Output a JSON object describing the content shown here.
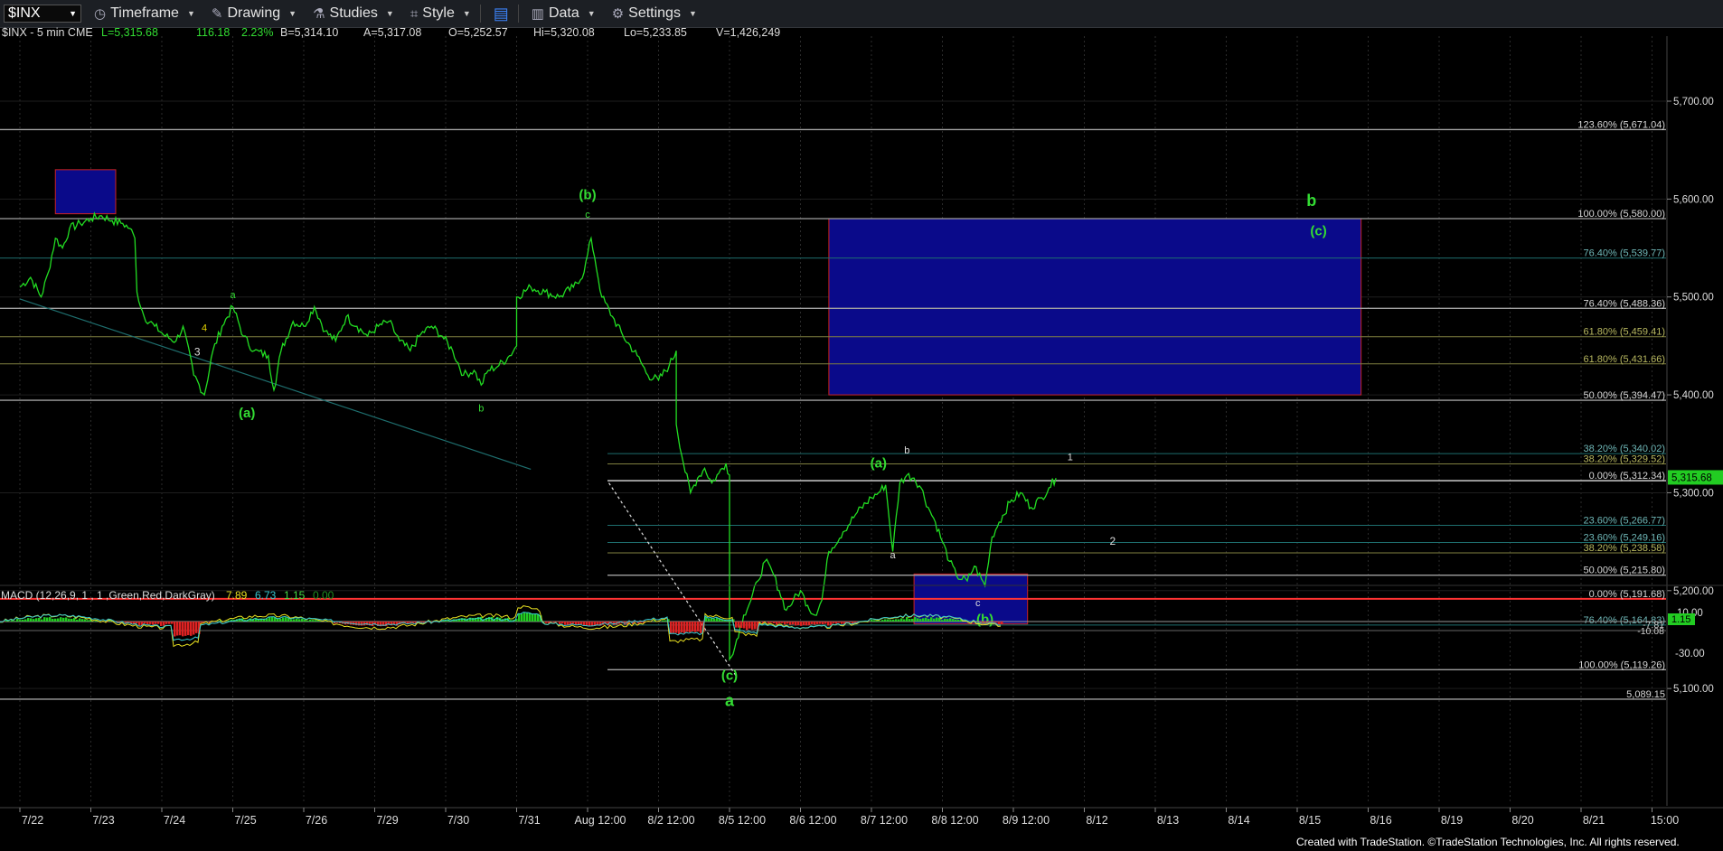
{
  "toolbar": {
    "symbol": "$INX",
    "items": [
      {
        "label": "Timeframe",
        "icon": "clock-icon"
      },
      {
        "label": "Drawing",
        "icon": "pencil-icon"
      },
      {
        "label": "Studies",
        "icon": "flask-icon"
      },
      {
        "label": "Style",
        "icon": "style-icon"
      },
      {
        "label": "",
        "icon": "layout-icon"
      },
      {
        "label": "Data",
        "icon": "bar-chart-icon"
      },
      {
        "label": "Settings",
        "icon": "gear-icon"
      }
    ]
  },
  "header": {
    "title": "$INX - 5 min  CME",
    "L": "L=5,315.68",
    "chg": "116.18",
    "pct": "2.23%",
    "B": "B=5,314.10",
    "A": "A=5,317.08",
    "O": "O=5,252.57",
    "Hi": "Hi=5,320.08",
    "Lo": "Lo=5,233.85",
    "V": "V=1,426,249"
  },
  "colors": {
    "bg": "#000000",
    "price": "#22dd22",
    "wave_label": "#33dd33",
    "grid": "#2a2a2a",
    "zone_fill": "#0a0a8a",
    "zone_border": "#cc2222",
    "red_line": "#ff3333",
    "teal": "#1e6e6e",
    "gray": "#a0a0a0",
    "olive": "#808040"
  },
  "chart_data": {
    "type": "line",
    "title": "$INX - 5 min",
    "y_axis": {
      "range": [
        5040,
        5720
      ],
      "ticks": [
        5100,
        5200,
        5300,
        5400,
        5500,
        5600,
        5700
      ],
      "labels": [
        "5,100.00",
        "5,200.00",
        "5,300.00",
        "5,400.00",
        "5,500.00",
        "5,600.00",
        "5,700.00"
      ]
    },
    "x_axis": {
      "labels": [
        "7/22",
        "7/23",
        "7/24",
        "7/25",
        "7/26",
        "7/29",
        "7/30",
        "7/31",
        "Aug 12:00",
        "8/2 12:00",
        "8/5 12:00",
        "8/6 12:00",
        "8/7 12:00",
        "8/8 12:00",
        "8/9 12:00",
        "8/12",
        "8/13",
        "8/14",
        "8/15",
        "8/16",
        "8/19",
        "8/20",
        "8/21",
        "15:00"
      ]
    },
    "last_price": "5,315.68",
    "fib_levels": [
      {
        "label": "123.60% (5,671.04)",
        "value": 5671,
        "color": "gray"
      },
      {
        "label": "100.00% (5,580.00)",
        "value": 5580,
        "color": "gray"
      },
      {
        "label": "76.40% (5,539.77)",
        "value": 5539.77,
        "color": "teal"
      },
      {
        "label": "76.40% (5,488.36)",
        "value": 5488.36,
        "color": "gray"
      },
      {
        "label": "61.80% (5,459.41)",
        "value": 5459.41,
        "color": "olive"
      },
      {
        "label": "61.80% (5,431.66)",
        "value": 5431.66,
        "color": "olive"
      },
      {
        "label": "50.00% (5,394.47)",
        "value": 5394.47,
        "color": "gray"
      },
      {
        "label": "38.20% (5,340.02)",
        "value": 5340.02,
        "color": "teal"
      },
      {
        "label": "38.20% (5,329.52)",
        "value": 5329.52,
        "color": "olive"
      },
      {
        "label": "0.00% (5,312.34)",
        "value": 5312.34,
        "color": "white"
      },
      {
        "label": "23.60% (5,266.77)",
        "value": 5266.77,
        "color": "teal"
      },
      {
        "label": "23.60% (5,249.16)",
        "value": 5249.16,
        "color": "teal"
      },
      {
        "label": "38.20% (5,238.58)",
        "value": 5238.58,
        "color": "olive"
      },
      {
        "label": "50.00% (5,215.80)",
        "value": 5215.8,
        "color": "gray"
      },
      {
        "label": "0.00% (5,191.68)",
        "value": 5191.68,
        "color": "red"
      },
      {
        "label": "76.40% (5,164.83)",
        "value": 5164.83,
        "color": "teal"
      },
      {
        "label": "100.00% (5,119.26)",
        "value": 5119.26,
        "color": "gray"
      },
      {
        "label": "5,089.15",
        "value": 5089.15,
        "color": "gray"
      }
    ],
    "zones": [
      {
        "name": "upper-left-zone",
        "x": [
          0.5,
          1.35
        ],
        "y": [
          5585,
          5630
        ]
      },
      {
        "name": "target-zone-b",
        "x": [
          11.4,
          18.9
        ],
        "y": [
          5400,
          5580
        ]
      },
      {
        "name": "support-zone-b",
        "x": [
          12.6,
          14.2
        ],
        "y": [
          5166,
          5217
        ]
      }
    ],
    "wave_labels": [
      {
        "text": "(b)",
        "x": 8.0,
        "y": 5600,
        "color": "green",
        "size": 15
      },
      {
        "text": "c",
        "x": 8.0,
        "y": 5581,
        "color": "green",
        "size": 11
      },
      {
        "text": "b",
        "x": 18.2,
        "y": 5593,
        "color": "green",
        "size": 18
      },
      {
        "text": "(c)",
        "x": 18.3,
        "y": 5563,
        "color": "green",
        "size": 15
      },
      {
        "text": "a",
        "x": 3.0,
        "y": 5499,
        "color": "green",
        "size": 11
      },
      {
        "text": "4",
        "x": 2.6,
        "y": 5465,
        "color": "yellow",
        "size": 11
      },
      {
        "text": "3",
        "x": 2.5,
        "y": 5440,
        "color": "white",
        "size": 12
      },
      {
        "text": "(a)",
        "x": 3.2,
        "y": 5377,
        "color": "green",
        "size": 15
      },
      {
        "text": "b",
        "x": 6.5,
        "y": 5383,
        "color": "green",
        "size": 11
      },
      {
        "text": "(a)",
        "x": 12.1,
        "y": 5326,
        "color": "green",
        "size": 15
      },
      {
        "text": "b",
        "x": 12.5,
        "y": 5340,
        "color": "white",
        "size": 11
      },
      {
        "text": "1",
        "x": 14.8,
        "y": 5333,
        "color": "white",
        "size": 11
      },
      {
        "text": "a",
        "x": 12.3,
        "y": 5233,
        "color": "white",
        "size": 11
      },
      {
        "text": "2",
        "x": 15.4,
        "y": 5247,
        "color": "white",
        "size": 12
      },
      {
        "text": "c",
        "x": 13.5,
        "y": 5184,
        "color": "white",
        "size": 11
      },
      {
        "text": "(b)",
        "x": 13.6,
        "y": 5166,
        "color": "green",
        "size": 15
      },
      {
        "text": "(c)",
        "x": 10.0,
        "y": 5109,
        "color": "green",
        "size": 15
      },
      {
        "text": "a",
        "x": 10.0,
        "y": 5082,
        "color": "green",
        "size": 18
      }
    ],
    "price_series": [
      [
        0,
        5510
      ],
      [
        0.15,
        5520
      ],
      [
        0.3,
        5500
      ],
      [
        0.4,
        5525
      ],
      [
        0.5,
        5560
      ],
      [
        0.6,
        5550
      ],
      [
        0.7,
        5570
      ],
      [
        0.85,
        5575
      ],
      [
        1.0,
        5580
      ],
      [
        1.15,
        5583
      ],
      [
        1.3,
        5578
      ],
      [
        1.45,
        5575
      ],
      [
        1.55,
        5570
      ],
      [
        1.62,
        5560
      ],
      [
        1.65,
        5505
      ],
      [
        1.75,
        5480
      ],
      [
        1.9,
        5470
      ],
      [
        2.05,
        5460
      ],
      [
        2.2,
        5455
      ],
      [
        2.3,
        5470
      ],
      [
        2.45,
        5420
      ],
      [
        2.6,
        5400
      ],
      [
        2.72,
        5445
      ],
      [
        2.85,
        5470
      ],
      [
        3.0,
        5490
      ],
      [
        3.15,
        5460
      ],
      [
        3.3,
        5445
      ],
      [
        3.5,
        5440
      ],
      [
        3.58,
        5405
      ],
      [
        3.68,
        5445
      ],
      [
        3.85,
        5475
      ],
      [
        4.0,
        5470
      ],
      [
        4.15,
        5490
      ],
      [
        4.3,
        5465
      ],
      [
        4.45,
        5455
      ],
      [
        4.6,
        5480
      ],
      [
        4.75,
        5470
      ],
      [
        4.9,
        5460
      ],
      [
        5.05,
        5470
      ],
      [
        5.2,
        5475
      ],
      [
        5.35,
        5455
      ],
      [
        5.5,
        5445
      ],
      [
        5.65,
        5462
      ],
      [
        5.8,
        5470
      ],
      [
        5.95,
        5460
      ],
      [
        6.1,
        5445
      ],
      [
        6.25,
        5420
      ],
      [
        6.4,
        5425
      ],
      [
        6.5,
        5410
      ],
      [
        6.6,
        5425
      ],
      [
        6.75,
        5430
      ],
      [
        6.9,
        5440
      ],
      [
        7.0,
        5450
      ],
      [
        7.0,
        5500
      ],
      [
        7.2,
        5510
      ],
      [
        7.4,
        5505
      ],
      [
        7.6,
        5500
      ],
      [
        7.8,
        5510
      ],
      [
        7.95,
        5525
      ],
      [
        8.05,
        5560
      ],
      [
        8.1,
        5540
      ],
      [
        8.2,
        5500
      ],
      [
        8.35,
        5480
      ],
      [
        8.5,
        5460
      ],
      [
        8.7,
        5440
      ],
      [
        8.85,
        5420
      ],
      [
        9.0,
        5415
      ],
      [
        9.15,
        5430
      ],
      [
        9.25,
        5445
      ],
      [
        9.25,
        5370
      ],
      [
        9.35,
        5330
      ],
      [
        9.45,
        5300
      ],
      [
        9.55,
        5315
      ],
      [
        9.65,
        5325
      ],
      [
        9.75,
        5310
      ],
      [
        9.85,
        5320
      ],
      [
        9.95,
        5330
      ],
      [
        10.0,
        5318
      ],
      [
        10.0,
        5130
      ],
      [
        10.05,
        5135
      ],
      [
        10.1,
        5150
      ],
      [
        10.2,
        5175
      ],
      [
        10.3,
        5190
      ],
      [
        10.4,
        5210
      ],
      [
        10.5,
        5230
      ],
      [
        10.6,
        5220
      ],
      [
        10.7,
        5200
      ],
      [
        10.8,
        5180
      ],
      [
        10.9,
        5190
      ],
      [
        11.0,
        5200
      ],
      [
        11.1,
        5185
      ],
      [
        11.2,
        5175
      ],
      [
        11.3,
        5190
      ],
      [
        11.4,
        5240
      ],
      [
        11.6,
        5260
      ],
      [
        11.8,
        5280
      ],
      [
        12.0,
        5295
      ],
      [
        12.1,
        5300
      ],
      [
        12.2,
        5308
      ],
      [
        12.3,
        5240
      ],
      [
        12.4,
        5310
      ],
      [
        12.5,
        5318
      ],
      [
        12.6,
        5315
      ],
      [
        12.7,
        5305
      ],
      [
        12.8,
        5285
      ],
      [
        12.9,
        5270
      ],
      [
        13.0,
        5250
      ],
      [
        13.1,
        5230
      ],
      [
        13.2,
        5215
      ],
      [
        13.35,
        5210
      ],
      [
        13.45,
        5225
      ],
      [
        13.55,
        5212
      ],
      [
        13.6,
        5205
      ],
      [
        13.7,
        5255
      ],
      [
        13.8,
        5270
      ],
      [
        13.95,
        5290
      ],
      [
        14.1,
        5300
      ],
      [
        14.25,
        5285
      ],
      [
        14.4,
        5295
      ],
      [
        14.5,
        5305
      ],
      [
        14.6,
        5315
      ]
    ],
    "trendlines": [
      {
        "from": [
          0,
          5498
        ],
        "to": [
          7.2,
          5324
        ],
        "color": "teal"
      },
      {
        "from": [
          8.3,
          5310
        ],
        "to": [
          10.1,
          5112
        ],
        "color": "white",
        "dashed": true
      }
    ],
    "macd": {
      "title": "MACD (12,26,9, 1 , 1 ,Green,Red,DarkGray)",
      "values": [
        "7.89",
        "6.73",
        "1.15",
        "0.00"
      ],
      "y_ticks": [
        "10.00",
        "-30.00"
      ],
      "side_labels": [
        "1.15",
        "-7.81",
        "-10.08"
      ]
    }
  },
  "footer": "Created with TradeStation. ©TradeStation Technologies, Inc. All rights reserved."
}
